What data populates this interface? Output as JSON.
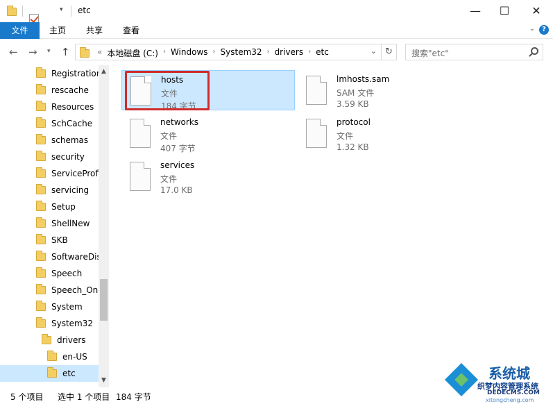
{
  "window": {
    "title": "etc"
  },
  "ribbon": {
    "tabs": [
      {
        "label": "文件"
      },
      {
        "label": "主页"
      },
      {
        "label": "共享"
      },
      {
        "label": "查看"
      }
    ],
    "help_label": "?"
  },
  "address": {
    "prefix": "«",
    "crumbs": [
      "本地磁盘 (C:)",
      "Windows",
      "System32",
      "drivers",
      "etc"
    ]
  },
  "search": {
    "placeholder": "搜索\"etc\""
  },
  "nav_tree": {
    "items": [
      {
        "label": "Registration"
      },
      {
        "label": "rescache"
      },
      {
        "label": "Resources"
      },
      {
        "label": "SchCache"
      },
      {
        "label": "schemas"
      },
      {
        "label": "security"
      },
      {
        "label": "ServiceProfil"
      },
      {
        "label": "servicing"
      },
      {
        "label": "Setup"
      },
      {
        "label": "ShellNew"
      },
      {
        "label": "SKB"
      },
      {
        "label": "SoftwareDist"
      },
      {
        "label": "Speech"
      },
      {
        "label": "Speech_One"
      },
      {
        "label": "System"
      },
      {
        "label": "System32"
      },
      {
        "label": "drivers"
      },
      {
        "label": "en-US"
      },
      {
        "label": "etc"
      }
    ],
    "selected": "etc"
  },
  "files": [
    {
      "name": "hosts",
      "type": "文件",
      "size": "184 字节",
      "selected": true
    },
    {
      "name": "lmhosts.sam",
      "type": "SAM 文件",
      "size": "3.59 KB",
      "selected": false
    },
    {
      "name": "networks",
      "type": "文件",
      "size": "407 字节",
      "selected": false
    },
    {
      "name": "protocol",
      "type": "文件",
      "size": "1.32 KB",
      "selected": false
    },
    {
      "name": "services",
      "type": "文件",
      "size": "17.0 KB",
      "selected": false
    }
  ],
  "status": {
    "item_count": "5 个项目",
    "selection": "选中 1 个项目",
    "selection_size": "184 字节"
  },
  "watermark": {
    "line1": "系统城",
    "line2": "织梦内容管理系统",
    "line3": "DEDECMS.COM",
    "line4": "xitongcheng.com"
  },
  "colors": {
    "accent": "#1979ca",
    "selection": "#cce8ff",
    "highlight_border": "#d12b2b",
    "folder": "#f3cf63"
  }
}
